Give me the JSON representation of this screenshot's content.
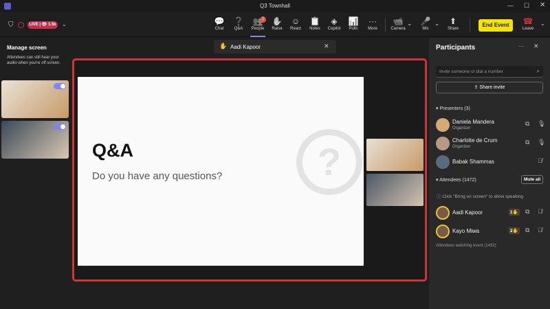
{
  "window": {
    "title": "Q3 Townhall"
  },
  "status": {
    "live_label": "LIVE",
    "viewers": "1.5k"
  },
  "toolbar": {
    "items": [
      {
        "label": "Chat",
        "icon": "chat-icon",
        "glyph": "💬"
      },
      {
        "label": "Q&A",
        "icon": "qa-icon",
        "glyph": "❓"
      },
      {
        "label": "People",
        "icon": "people-icon",
        "glyph": "👥",
        "badge": "2"
      },
      {
        "label": "Raise",
        "icon": "raise-hand-icon",
        "glyph": "✋"
      },
      {
        "label": "React",
        "icon": "react-icon",
        "glyph": "☺"
      },
      {
        "label": "Notes",
        "icon": "notes-icon",
        "glyph": "📋"
      },
      {
        "label": "Copilot",
        "icon": "copilot-icon",
        "glyph": "◈"
      },
      {
        "label": "Polls",
        "icon": "polls-icon",
        "glyph": "📊"
      },
      {
        "label": "More",
        "icon": "more-icon",
        "glyph": "···"
      },
      {
        "label": "Camera",
        "icon": "camera-icon",
        "glyph": "📹"
      },
      {
        "label": "Mic",
        "icon": "mic-icon",
        "glyph": "🎤"
      },
      {
        "label": "Share",
        "icon": "share-icon",
        "glyph": "⬆"
      }
    ],
    "end_event": "End Event",
    "leave": "Leave"
  },
  "left": {
    "title": "Manage screen",
    "desc": "Attendees can still hear your audio when you're off screen."
  },
  "raised_hand": {
    "name": "Aadi Kapoor"
  },
  "slide": {
    "title": "Q&A",
    "subtitle": "Do you have any questions?"
  },
  "panel": {
    "title": "Participants",
    "search_placeholder": "Invite someone or dial a number",
    "share_invite": "Share invite",
    "presenters_header": "Presenters (3)",
    "presenters": [
      {
        "name": "Daniela Mandera",
        "role": "Organizer"
      },
      {
        "name": "Charlotte de Crum",
        "role": "Organizer"
      },
      {
        "name": "Babak Shammas",
        "role": ""
      }
    ],
    "attendees_header": "Attendees (1472)",
    "mute_all": "Mute all",
    "info": "Click \"Bring on screen\" to allow speaking",
    "attendees": [
      {
        "name": "Aadi Kapoor",
        "hand": "1"
      },
      {
        "name": "Kayo Miwa",
        "hand": "2"
      }
    ],
    "watching": "Attendees watching event (1432)"
  },
  "colors": {
    "accent": "#d13438",
    "end_event": "#f4e20b",
    "live": "#c4314b"
  }
}
